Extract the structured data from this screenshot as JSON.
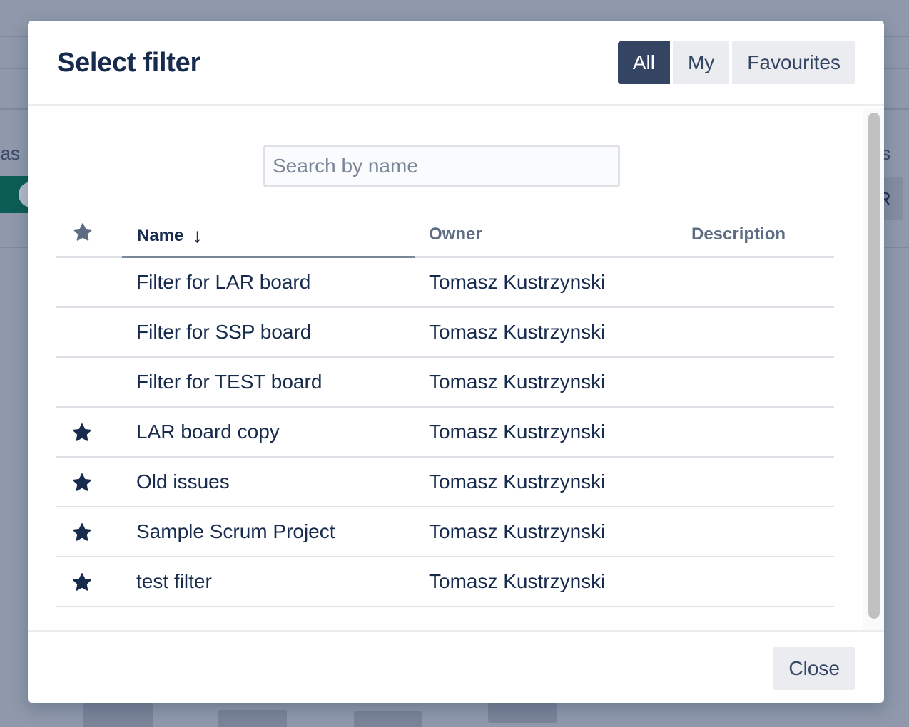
{
  "background": {
    "left_text": "bas",
    "right_text": "ts",
    "right_button_text": "R"
  },
  "dialog": {
    "title": "Select filter",
    "segments": [
      {
        "label": "All",
        "active": true
      },
      {
        "label": "My",
        "active": false
      },
      {
        "label": "Favourites",
        "active": false
      }
    ],
    "search": {
      "placeholder": "Search by name",
      "value": ""
    },
    "table": {
      "columns": {
        "favourite_icon": "star-icon",
        "name": "Name",
        "owner": "Owner",
        "description": "Description"
      },
      "sort": {
        "column": "Name",
        "direction": "descending-arrow"
      },
      "rows": [
        {
          "favourite": false,
          "name": "Filter for LAR board",
          "owner": "Tomasz Kustrzynski",
          "description": ""
        },
        {
          "favourite": false,
          "name": "Filter for SSP board",
          "owner": "Tomasz Kustrzynski",
          "description": ""
        },
        {
          "favourite": false,
          "name": "Filter for TEST board",
          "owner": "Tomasz Kustrzynski",
          "description": ""
        },
        {
          "favourite": true,
          "name": "LAR board copy",
          "owner": "Tomasz Kustrzynski",
          "description": ""
        },
        {
          "favourite": true,
          "name": "Old issues",
          "owner": "Tomasz Kustrzynski",
          "description": ""
        },
        {
          "favourite": true,
          "name": "Sample Scrum Project",
          "owner": "Tomasz Kustrzynski",
          "description": ""
        },
        {
          "favourite": true,
          "name": "test filter",
          "owner": "Tomasz Kustrzynski",
          "description": ""
        }
      ]
    },
    "footer": {
      "close_label": "Close"
    }
  },
  "colors": {
    "primary_text": "#172b4d",
    "active_segment": "#344563",
    "header_star": "#5e6c84",
    "overlay": "#8f99ab"
  }
}
